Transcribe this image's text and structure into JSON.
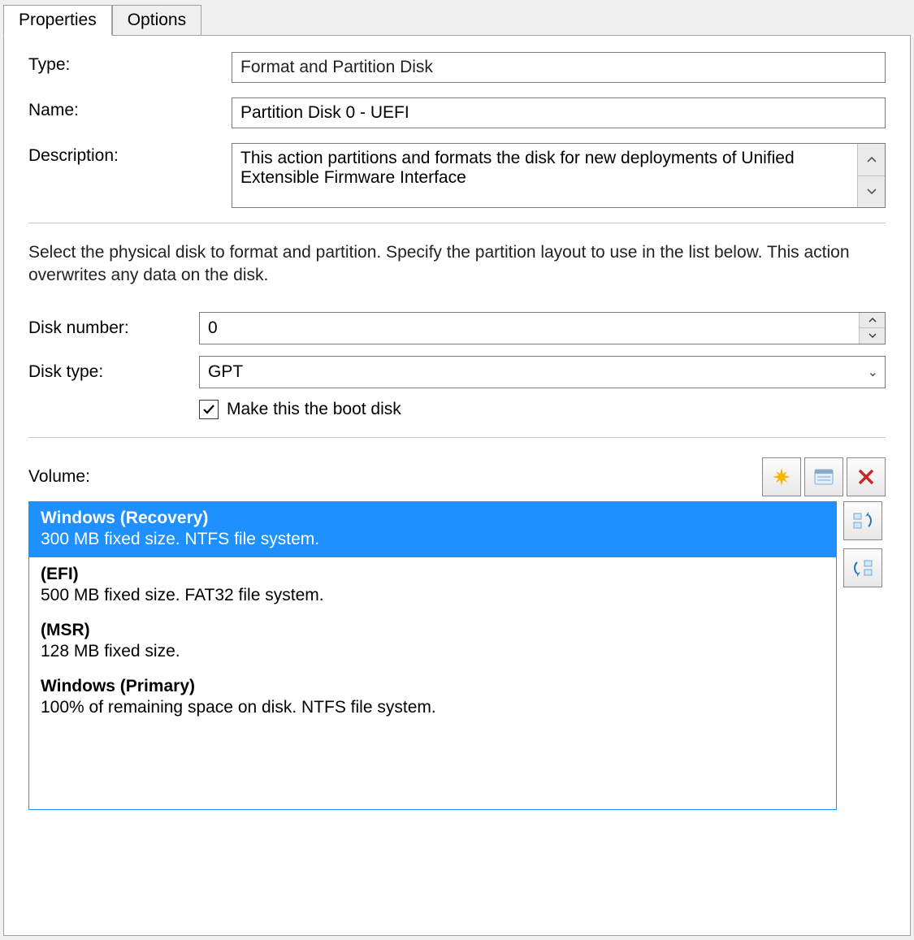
{
  "tabs": {
    "properties": "Properties",
    "options": "Options",
    "active": "properties"
  },
  "fields": {
    "type_label": "Type:",
    "type_value": "Format and Partition Disk",
    "name_label": "Name:",
    "name_value": "Partition Disk 0 - UEFI",
    "description_label": "Description:",
    "description_value": "This action partitions and formats the disk for new deployments of Unified Extensible Firmware Interface"
  },
  "instruction": "Select the physical disk to format and partition. Specify the partition layout to use in the list below. This action overwrites any data on the disk.",
  "disk": {
    "number_label": "Disk number:",
    "number_value": "0",
    "type_label": "Disk type:",
    "type_value": "GPT",
    "boot_label": "Make this the boot disk",
    "boot_checked": true
  },
  "volume": {
    "label": "Volume:",
    "items": [
      {
        "title": "Windows (Recovery)",
        "sub": "300 MB fixed size. NTFS file system.",
        "selected": true
      },
      {
        "title": "(EFI)",
        "sub": "500 MB fixed size. FAT32 file system.",
        "selected": false
      },
      {
        "title": "(MSR)",
        "sub": "128 MB fixed size.",
        "selected": false
      },
      {
        "title": "Windows (Primary)",
        "sub": "100% of remaining space on disk. NTFS file system.",
        "selected": false
      }
    ]
  },
  "icons": {
    "new": "new-icon",
    "properties": "properties-icon",
    "delete": "delete-icon",
    "move_up": "move-up-icon",
    "move_down": "move-down-icon"
  }
}
